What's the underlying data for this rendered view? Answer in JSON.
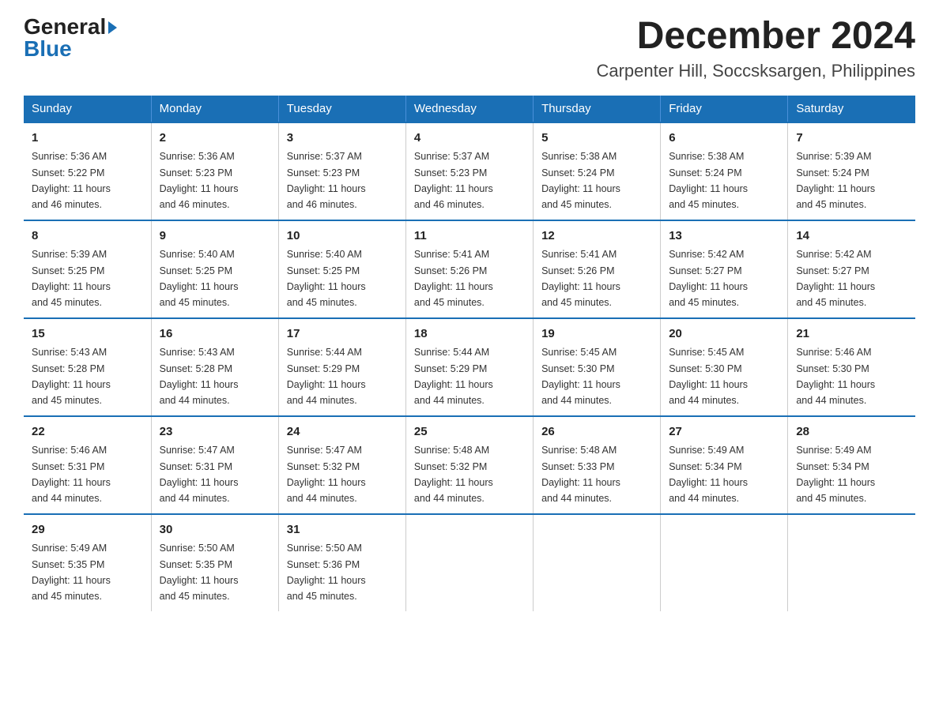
{
  "logo": {
    "text_general": "General",
    "arrow": "▶",
    "text_blue": "Blue"
  },
  "title": "December 2024",
  "subtitle": "Carpenter Hill, Soccsksargen, Philippines",
  "days_of_week": [
    "Sunday",
    "Monday",
    "Tuesday",
    "Wednesday",
    "Thursday",
    "Friday",
    "Saturday"
  ],
  "weeks": [
    [
      {
        "num": "1",
        "sunrise": "5:36 AM",
        "sunset": "5:22 PM",
        "daylight": "11 hours and 46 minutes."
      },
      {
        "num": "2",
        "sunrise": "5:36 AM",
        "sunset": "5:23 PM",
        "daylight": "11 hours and 46 minutes."
      },
      {
        "num": "3",
        "sunrise": "5:37 AM",
        "sunset": "5:23 PM",
        "daylight": "11 hours and 46 minutes."
      },
      {
        "num": "4",
        "sunrise": "5:37 AM",
        "sunset": "5:23 PM",
        "daylight": "11 hours and 46 minutes."
      },
      {
        "num": "5",
        "sunrise": "5:38 AM",
        "sunset": "5:24 PM",
        "daylight": "11 hours and 45 minutes."
      },
      {
        "num": "6",
        "sunrise": "5:38 AM",
        "sunset": "5:24 PM",
        "daylight": "11 hours and 45 minutes."
      },
      {
        "num": "7",
        "sunrise": "5:39 AM",
        "sunset": "5:24 PM",
        "daylight": "11 hours and 45 minutes."
      }
    ],
    [
      {
        "num": "8",
        "sunrise": "5:39 AM",
        "sunset": "5:25 PM",
        "daylight": "11 hours and 45 minutes."
      },
      {
        "num": "9",
        "sunrise": "5:40 AM",
        "sunset": "5:25 PM",
        "daylight": "11 hours and 45 minutes."
      },
      {
        "num": "10",
        "sunrise": "5:40 AM",
        "sunset": "5:25 PM",
        "daylight": "11 hours and 45 minutes."
      },
      {
        "num": "11",
        "sunrise": "5:41 AM",
        "sunset": "5:26 PM",
        "daylight": "11 hours and 45 minutes."
      },
      {
        "num": "12",
        "sunrise": "5:41 AM",
        "sunset": "5:26 PM",
        "daylight": "11 hours and 45 minutes."
      },
      {
        "num": "13",
        "sunrise": "5:42 AM",
        "sunset": "5:27 PM",
        "daylight": "11 hours and 45 minutes."
      },
      {
        "num": "14",
        "sunrise": "5:42 AM",
        "sunset": "5:27 PM",
        "daylight": "11 hours and 45 minutes."
      }
    ],
    [
      {
        "num": "15",
        "sunrise": "5:43 AM",
        "sunset": "5:28 PM",
        "daylight": "11 hours and 45 minutes."
      },
      {
        "num": "16",
        "sunrise": "5:43 AM",
        "sunset": "5:28 PM",
        "daylight": "11 hours and 44 minutes."
      },
      {
        "num": "17",
        "sunrise": "5:44 AM",
        "sunset": "5:29 PM",
        "daylight": "11 hours and 44 minutes."
      },
      {
        "num": "18",
        "sunrise": "5:44 AM",
        "sunset": "5:29 PM",
        "daylight": "11 hours and 44 minutes."
      },
      {
        "num": "19",
        "sunrise": "5:45 AM",
        "sunset": "5:30 PM",
        "daylight": "11 hours and 44 minutes."
      },
      {
        "num": "20",
        "sunrise": "5:45 AM",
        "sunset": "5:30 PM",
        "daylight": "11 hours and 44 minutes."
      },
      {
        "num": "21",
        "sunrise": "5:46 AM",
        "sunset": "5:30 PM",
        "daylight": "11 hours and 44 minutes."
      }
    ],
    [
      {
        "num": "22",
        "sunrise": "5:46 AM",
        "sunset": "5:31 PM",
        "daylight": "11 hours and 44 minutes."
      },
      {
        "num": "23",
        "sunrise": "5:47 AM",
        "sunset": "5:31 PM",
        "daylight": "11 hours and 44 minutes."
      },
      {
        "num": "24",
        "sunrise": "5:47 AM",
        "sunset": "5:32 PM",
        "daylight": "11 hours and 44 minutes."
      },
      {
        "num": "25",
        "sunrise": "5:48 AM",
        "sunset": "5:32 PM",
        "daylight": "11 hours and 44 minutes."
      },
      {
        "num": "26",
        "sunrise": "5:48 AM",
        "sunset": "5:33 PM",
        "daylight": "11 hours and 44 minutes."
      },
      {
        "num": "27",
        "sunrise": "5:49 AM",
        "sunset": "5:34 PM",
        "daylight": "11 hours and 44 minutes."
      },
      {
        "num": "28",
        "sunrise": "5:49 AM",
        "sunset": "5:34 PM",
        "daylight": "11 hours and 45 minutes."
      }
    ],
    [
      {
        "num": "29",
        "sunrise": "5:49 AM",
        "sunset": "5:35 PM",
        "daylight": "11 hours and 45 minutes."
      },
      {
        "num": "30",
        "sunrise": "5:50 AM",
        "sunset": "5:35 PM",
        "daylight": "11 hours and 45 minutes."
      },
      {
        "num": "31",
        "sunrise": "5:50 AM",
        "sunset": "5:36 PM",
        "daylight": "11 hours and 45 minutes."
      },
      null,
      null,
      null,
      null
    ]
  ],
  "labels": {
    "sunrise": "Sunrise:",
    "sunset": "Sunset:",
    "daylight": "Daylight:"
  }
}
